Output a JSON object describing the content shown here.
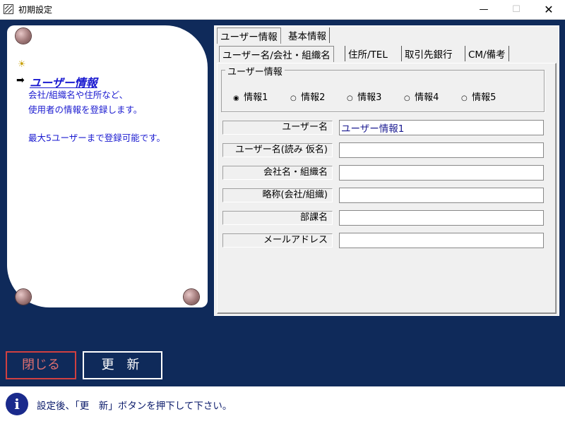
{
  "window": {
    "title": "初期設定",
    "minimize": "—",
    "maximize": "☐",
    "close": "✕"
  },
  "left_panel": {
    "bulb_icon": "light-bulb-icon",
    "arrow_icon": "right-arrow-icon",
    "heading": "ユーザー情報",
    "desc_line1": "会社/組織名や住所など、",
    "desc_line2": "使用者の情報を登録します。",
    "desc_line3": "最大5ユーザーまで登録可能です。"
  },
  "tabs_row1": [
    {
      "label": "ユーザー情報",
      "active": true
    },
    {
      "label": "基本情報",
      "active": false
    }
  ],
  "tabs_row2": [
    {
      "label": "ユーザー名/会社・組織名",
      "active": true
    },
    {
      "label": "住所/TEL",
      "active": false
    },
    {
      "label": "取引先銀行",
      "active": false
    },
    {
      "label": "CM/備考",
      "active": false
    }
  ],
  "group": {
    "label": "ユーザー情報",
    "radios": [
      {
        "label": "情報1",
        "selected": true
      },
      {
        "label": "情報2",
        "selected": false
      },
      {
        "label": "情報3",
        "selected": false
      },
      {
        "label": "情報4",
        "selected": false
      },
      {
        "label": "情報5",
        "selected": false
      }
    ]
  },
  "fields": [
    {
      "label": "ユーザー名",
      "value": "ユーザー情報1"
    },
    {
      "label": "ユーザー名(読み 仮名)",
      "value": ""
    },
    {
      "label": "会社名・組織名",
      "value": ""
    },
    {
      "label": "略称(会社/組織)",
      "value": ""
    },
    {
      "label": "部課名",
      "value": ""
    },
    {
      "label": "メールアドレス",
      "value": ""
    }
  ],
  "buttons": {
    "close_label": "閉じる",
    "update_label": "更 新"
  },
  "status": {
    "icon": "info-icon",
    "icon_glyph": "i",
    "text": "設定後、「更　新」ボタンを押下して下さい。"
  },
  "colors": {
    "background": "#0f2a5a",
    "text_blue": "#1a1ad0",
    "close_red": "#d04040"
  }
}
